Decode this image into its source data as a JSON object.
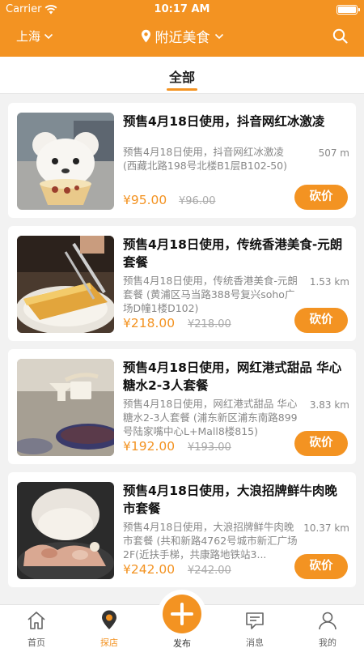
{
  "status": {
    "carrier": "Carrier",
    "time": "10:17 AM"
  },
  "nav": {
    "city": "上海",
    "title": "附近美食"
  },
  "tabs": {
    "active": "全部"
  },
  "items": [
    {
      "name": "预售4月18日使用，抖音网红冰激凌",
      "desc": "预售4月18日使用，抖音网红冰激凌 (西藏北路198号北楼B1层B102-50)",
      "distance": "507 m",
      "price": "¥95.00",
      "old_price": "¥96.00",
      "action": "砍价"
    },
    {
      "name": "预售4月18日使用，传统香港美食-元朗套餐",
      "desc": "预售4月18日使用，传统香港美食-元朗套餐 (黄浦区马当路388号复兴soho广场D幢1楼D102)",
      "distance": "1.53 km",
      "price": "¥218.00",
      "old_price": "¥218.00",
      "action": "砍价"
    },
    {
      "name": "预售4月18日使用，网红港式甜品 华心糖水2-3人套餐",
      "desc": "预售4月18日使用，网红港式甜品 华心糖水2-3人套餐 (浦东新区浦东南路899号陆家嘴中心L+Mall8楼815)",
      "distance": "3.83 km",
      "price": "¥192.00",
      "old_price": "¥193.00",
      "action": "砍价"
    },
    {
      "name": "预售4月18日使用，大浪招牌鲜牛肉晚市套餐",
      "desc": "预售4月18日使用，大浪招牌鲜牛肉晚市套餐 (共和新路4762号城市新汇广场2F(近扶手梯，共康路地铁站3...",
      "distance": "10.37 km",
      "price": "¥242.00",
      "old_price": "¥242.00",
      "action": "砍价"
    }
  ],
  "tabbar": {
    "home": "首页",
    "explore": "探店",
    "publish": "发布",
    "messages": "消息",
    "mine": "我的"
  },
  "colors": {
    "accent": "#f39322",
    "background": "#f2f2f2"
  },
  "icons": [
    "wifi-icon",
    "battery-icon",
    "chevron-down-icon",
    "location-pin-icon",
    "search-icon",
    "home-icon",
    "explore-icon",
    "plus-icon",
    "message-icon",
    "user-icon"
  ]
}
